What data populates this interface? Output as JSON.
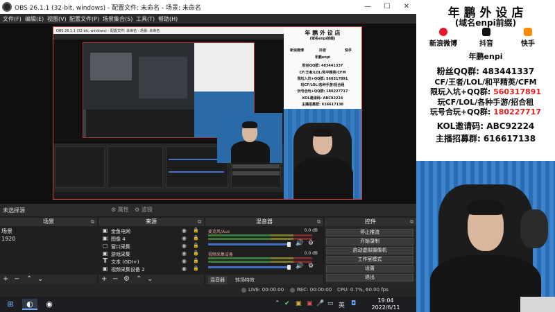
{
  "window": {
    "title": "OBS 26.1.1 (32-bit, windows) - 配置文件: 未命名 - 场景: 未命名",
    "minimize": "—",
    "maximize": "☐",
    "close": "✕"
  },
  "menu": [
    "文件(F)",
    "编辑(E)",
    "视图(V)",
    "配置文件(P)",
    "场景集合(S)",
    "工具(T)",
    "帮助(H)"
  ],
  "nested": {
    "title": "OBS 26.1.1 (32-bit, windows) - 配置文件: 未命名 - 场景: 未命名"
  },
  "poster_small": {
    "title": "年 鹏 外 设 店",
    "subtitle": "(域名enpi前缀)",
    "socials": [
      "新浪微博",
      "抖音",
      "快手"
    ],
    "brand": "年鹏enpi",
    "lines": [
      "粉丝QQ群: 483441337",
      "CF/王者/LOL/和平精英/CFM",
      "限玩入坑+QQ群: 560317891",
      "玩CF/LOL/各种手游/招合租",
      "玩号合玩+QQ群: 180227717",
      "KOL邀请码: ABC92224",
      "主播招募群: 616617138"
    ]
  },
  "poster_big": {
    "title": "年 鹏 外 设 店",
    "subtitle": "(域名enpi前缀)",
    "socials": [
      "新浪微博",
      "抖音",
      "快手"
    ],
    "brand": "年鹏enpi",
    "qq_fans": "粉丝QQ群: 483441337",
    "games": "CF/王者/LOL/和平精英/CFM",
    "group1_label": "限玩入坑+QQ群: ",
    "group1_num": "560317891",
    "games2": "玩CF/LOL/各种手游/招合租",
    "group2_label": "玩号合玩+QQ群: ",
    "group2_num": "180227717",
    "kol": "KOL邀请码: ABC92224",
    "recruit": "主播招募群: 616617138"
  },
  "source_bar": {
    "no_source": "未选择源",
    "properties": "⚙ 属性",
    "filters": "⚙ 滤镜"
  },
  "scenes": {
    "header": "场景",
    "items": [
      "场景",
      "1920"
    ]
  },
  "sources": {
    "header": "来源",
    "items": [
      {
        "icon": "▣",
        "name": "金鱼电网"
      },
      {
        "icon": "▣",
        "name": "图像 4"
      },
      {
        "icon": "▢",
        "name": "窗口采集"
      },
      {
        "icon": "▣",
        "name": "游戏采集"
      },
      {
        "icon": "T",
        "name": "文本 (GDI+)"
      },
      {
        "icon": "▣",
        "name": "视频采集设备 2"
      }
    ]
  },
  "mixer": {
    "header": "混音器",
    "tracks": [
      {
        "name": "麦克风/Aux",
        "db": "0.0 dB",
        "level": 0.78
      },
      {
        "name": "视频采集设备",
        "db": "0.0 dB",
        "level": 0.78
      }
    ],
    "tabs": [
      "混音器",
      "转场特效"
    ]
  },
  "controls": {
    "header": "控件",
    "buttons": [
      "停止推流",
      "开始录制",
      "启动虚拟摄像机",
      "工作室模式",
      "设置",
      "退出"
    ]
  },
  "status": {
    "live": "LIVE: 00:00:00",
    "rec": "REC: 00:00:00",
    "cpu": "CPU: 0.7%, 60.00 fps"
  },
  "taskbar": {
    "time": "19:04",
    "date": "2022/6/11",
    "ime": "英"
  },
  "colors": {
    "accent_red": "#e02020",
    "canvas_border": "#d94040",
    "fader_blue": "#4470c8"
  }
}
